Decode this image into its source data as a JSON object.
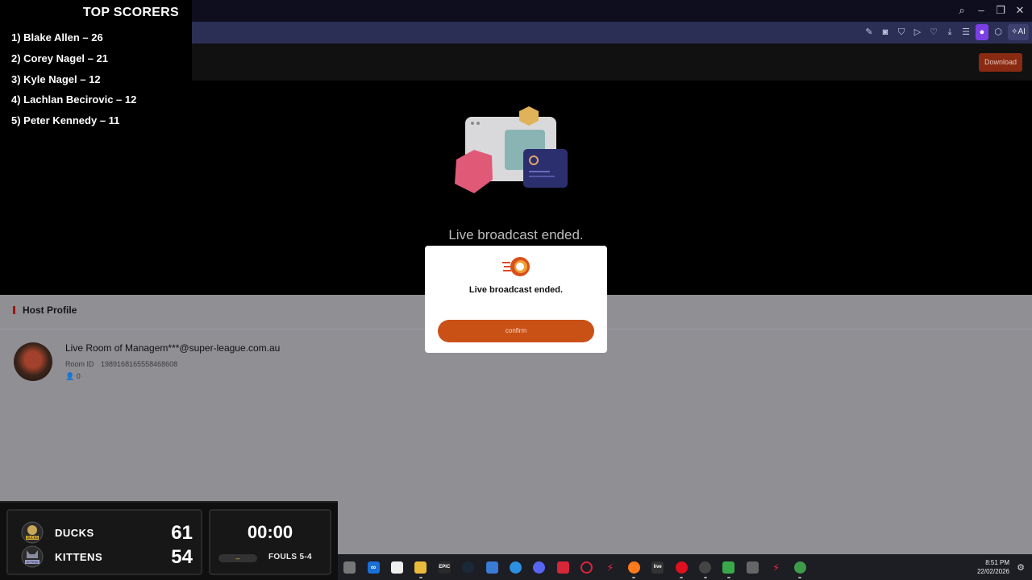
{
  "scorers": {
    "title": "TOP SCORERS",
    "entries": [
      "1) Blake Allen – 26",
      "2) Corey Nagel – 21",
      "3) Kyle Nagel – 12",
      "4) Lachlan Becirovic – 12",
      "5) Peter Kennedy – 11"
    ]
  },
  "header": {
    "download_label": "Download"
  },
  "player": {
    "message": "Live broadcast ended."
  },
  "host": {
    "section_title": "Host Profile",
    "room_name": "Live Room of Managem***@super-league.com.au",
    "room_id_label": "Room ID",
    "room_id": "1989168165558468608",
    "viewer_count": "0"
  },
  "modal": {
    "message": "Live broadcast ended.",
    "confirm_label": "confirm"
  },
  "scoreboard": {
    "team1": {
      "name": "DUCKS",
      "score": "61",
      "logo_text": "DUCKS"
    },
    "team2": {
      "name": "KITTENS",
      "score": "54",
      "logo_text": "KITTENS"
    },
    "clock": "00:00",
    "possession": "–",
    "fouls": "FOULS 5-4"
  },
  "taskbar": {
    "time": "8:51 PM",
    "date": "22/02/2026",
    "apps": [
      "task-view",
      "meta",
      "notepad",
      "file-explorer",
      "epic-games",
      "steam",
      "store",
      "app-installer",
      "discord",
      "app-red",
      "opera-gx",
      "flash-app",
      "firefox",
      "live-app",
      "opera",
      "obs",
      "screen-app",
      "snip-app",
      "flash-app-2",
      "chrome"
    ]
  },
  "colors": {
    "accent": "#c95116",
    "toolbar": "#2c2f55",
    "page_overlay": "#8f8f94"
  }
}
